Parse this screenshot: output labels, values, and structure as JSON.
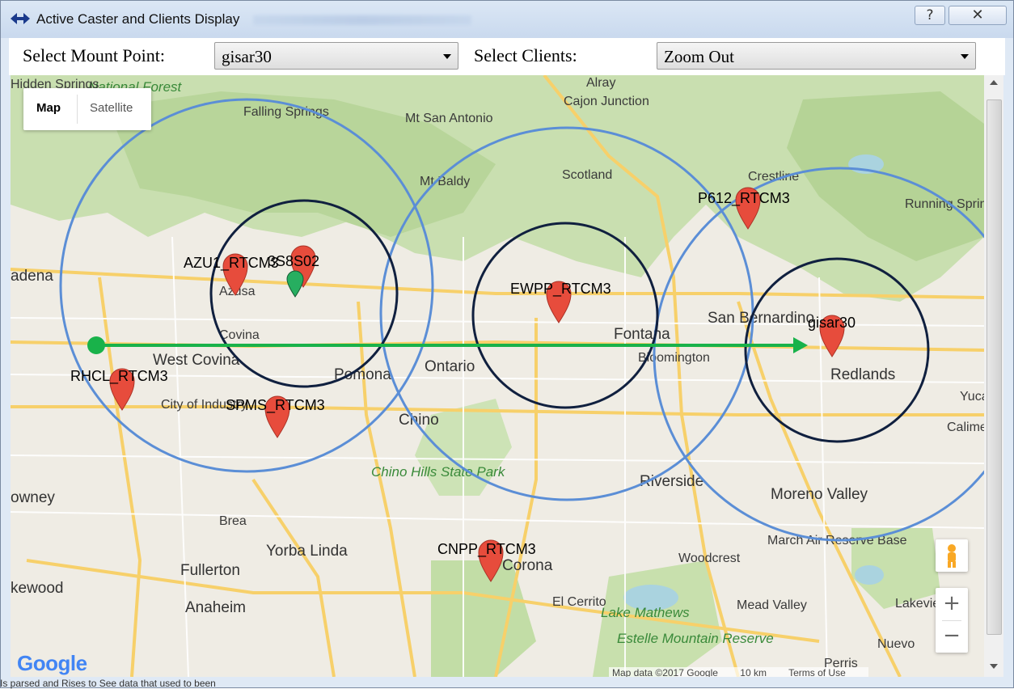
{
  "window": {
    "title": "Active Caster and Clients Display",
    "help_glyph": "?",
    "close_glyph": "✕"
  },
  "toolbar": {
    "mount_label": "Select Mount Point:",
    "mount_value": "gisar30",
    "clients_label": "Select Clients:",
    "clients_value": "Zoom Out"
  },
  "map": {
    "type_map": "Map",
    "type_satellite": "Satellite",
    "zoom_in": "+",
    "zoom_out": "−",
    "logo": "Google",
    "attribution": [
      "Map data ©2017 Google",
      "10 km",
      "Terms of Use"
    ],
    "stations": [
      {
        "label": "AZU1_RTCM3"
      },
      {
        "label": "3S8S02"
      },
      {
        "label": "EWPP_RTCM3"
      },
      {
        "label": "P612_RTCM3"
      },
      {
        "label": "gisar30"
      },
      {
        "label": "RHCL_RTCM3"
      },
      {
        "label": "SPMS_RTCM3"
      },
      {
        "label": "CNPP_RTCM3"
      }
    ],
    "places": [
      "Alray",
      "Cajon Junction",
      "Falling Springs",
      "Mt San Antonio",
      "Mt Baldy",
      "Scotland",
      "Crestline",
      "Running Springs",
      "Azusa",
      "Covina",
      "West Covina",
      "Pomona",
      "Ontario",
      "Fontana",
      "San Bernardino",
      "Bloomington",
      "Redlands",
      "City of Industry",
      "Chino",
      "Chino Hills State Park",
      "Riverside",
      "Moreno Valley",
      "Brea",
      "Yorba Linda",
      "Fullerton",
      "Anaheim",
      "Corona",
      "Woodcrest",
      "March Air Reserve Base",
      "El Cerrito",
      "Lake Mathews",
      "Estelle Mountain Reserve",
      "Mead Valley",
      "Perris",
      "Nuevo",
      "Lakeview",
      "Calimesa",
      "Yucaipa",
      "adena",
      "owney",
      "kewood",
      "National Forest",
      "Hidden Springs"
    ]
  },
  "below_text": "Is parsed and Rises to See data that used to been"
}
